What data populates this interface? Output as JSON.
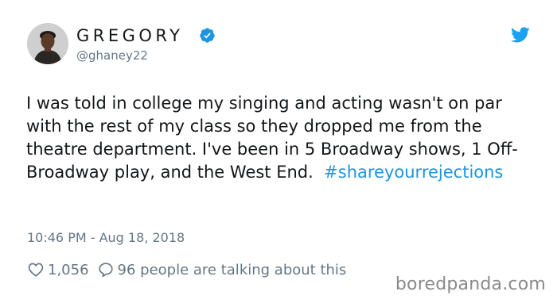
{
  "tweet": {
    "display_name": "GREGORY",
    "handle": "@ghaney22",
    "text": "I was told in college my singing and acting wasn't on par with the rest of my class so they dropped me from the theatre department. I've been in 5 Broadway shows, 1 Off-Broadway play, and the West End.",
    "hashtag": "#shareyourrejections",
    "timestamp": "10:46 PM - Aug 18, 2018",
    "likes": "1,056",
    "talking": "96 people are talking about this"
  },
  "icons": {
    "verified": "verified-badge-icon",
    "logo": "twitter-bird-icon",
    "like": "heart-icon",
    "reply": "speech-bubble-icon"
  },
  "colors": {
    "accent": "#1b95e0",
    "muted": "#657786",
    "text": "#14171a"
  },
  "watermark": "boredpanda.com"
}
